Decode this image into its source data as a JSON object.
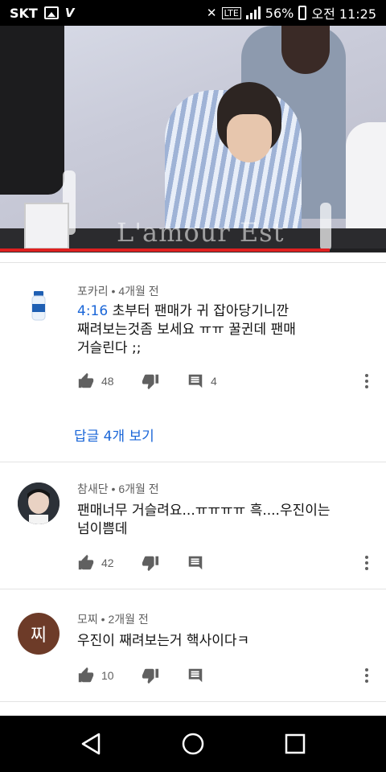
{
  "status_bar": {
    "carrier": "SKT",
    "battery_percent": "56%",
    "time": "오전 11:25",
    "icons": [
      "image-icon",
      "volte-icon",
      "mute-icon",
      "data-icon",
      "signal-icon",
      "battery-icon"
    ],
    "battery_level": 0.56
  },
  "video": {
    "watermark": "L'amour Est",
    "progress": 0.855,
    "progress_color": "#e02020"
  },
  "comments": [
    {
      "author": "포카리",
      "age": "4개월 전",
      "avatar": "pocari-bottle-avatar",
      "timestamp_link": "4:16",
      "text_line1": " 초부터 팬매가 귀 잡아당기니깐",
      "text_line2": "째려보는것좀 보세요 ㅠㅠ 꿀귄데 팬매",
      "text_line3": "거슬린다 ;;",
      "likes": "48",
      "replies": "4",
      "view_replies": "답글 4개 보기"
    },
    {
      "author": "참새단",
      "age": "6개월 전",
      "avatar": "photo-avatar",
      "text_line1": "팬매너무 거슬려요...ㅠㅠㅠㅠ 흑....우진이는",
      "text_line2": "넘이쁨데",
      "likes": "42"
    },
    {
      "author": "모찌",
      "age": "2개월 전",
      "avatar_letter": "찌",
      "avatar_color": "#6d3b28",
      "text_line1": "우진이 째려보는거 핵사이다ㅋ",
      "likes": "10"
    }
  ],
  "navbar": {
    "icons": [
      "back-icon",
      "home-icon",
      "recents-icon"
    ]
  },
  "colors": {
    "link": "#1a66d8",
    "meta": "#606060",
    "icon": "#606060"
  }
}
